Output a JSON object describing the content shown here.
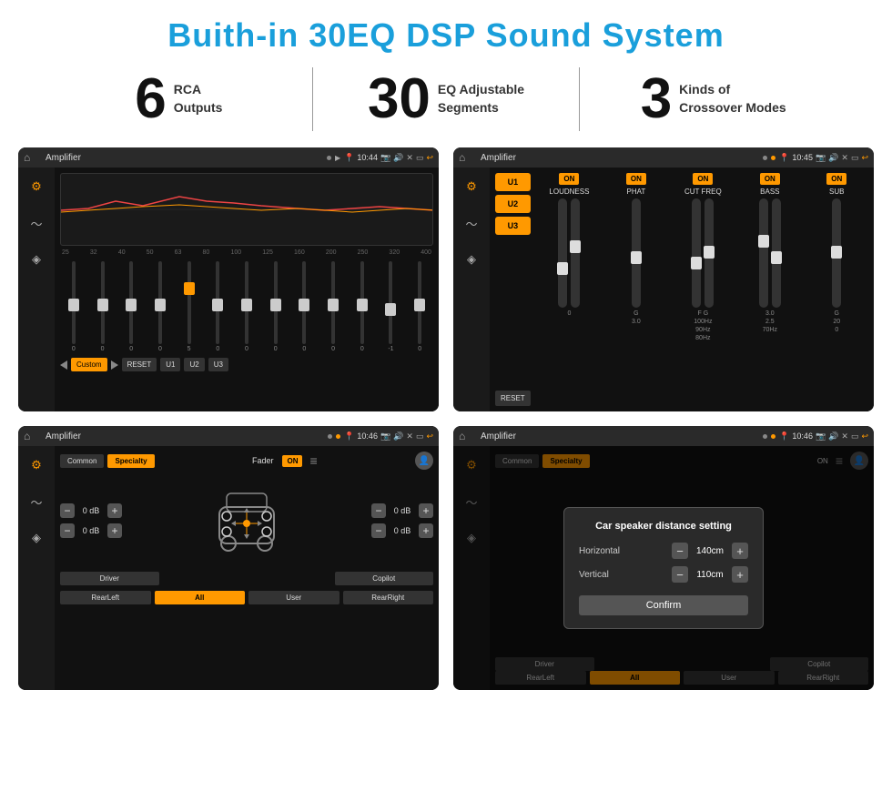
{
  "page": {
    "title": "Buith-in 30EQ DSP Sound System",
    "background": "#ffffff"
  },
  "stats": [
    {
      "number": "6",
      "label": "RCA\nOutputs"
    },
    {
      "number": "30",
      "label": "EQ Adjustable\nSegments"
    },
    {
      "number": "3",
      "label": "Kinds of\nCrossover Modes"
    }
  ],
  "screens": [
    {
      "id": "eq-screen",
      "title": "Amplifier",
      "time": "10:44",
      "type": "eq"
    },
    {
      "id": "crossover-screen",
      "title": "Amplifier",
      "time": "10:45",
      "type": "crossover"
    },
    {
      "id": "fader-screen",
      "title": "Amplifier",
      "time": "10:46",
      "type": "fader"
    },
    {
      "id": "dialog-screen",
      "title": "Amplifier",
      "time": "10:46",
      "type": "dialog"
    }
  ],
  "eq": {
    "frequencies": [
      "25",
      "32",
      "40",
      "50",
      "63",
      "80",
      "100",
      "125",
      "160",
      "200",
      "250",
      "320",
      "400"
    ],
    "values": [
      "0",
      "0",
      "0",
      "0",
      "5",
      "0",
      "0",
      "0",
      "0",
      "0",
      "0",
      "-1",
      "0"
    ],
    "preset": "Custom",
    "buttons": [
      "RESET",
      "U1",
      "U2",
      "U3"
    ]
  },
  "crossover": {
    "presets": [
      "U1",
      "U2",
      "U3"
    ],
    "sections": [
      "LOUDNESS",
      "PHAT",
      "CUT FREQ",
      "BASS",
      "SUB"
    ],
    "reset_label": "RESET"
  },
  "fader": {
    "tabs": [
      "Common",
      "Specialty"
    ],
    "fader_label": "Fader",
    "on_label": "ON",
    "vol_rows": [
      "0 dB",
      "0 dB",
      "0 dB",
      "0 dB"
    ],
    "buttons": [
      "Driver",
      "Copilot",
      "RearLeft",
      "All",
      "User",
      "RearRight"
    ]
  },
  "dialog": {
    "title": "Car speaker distance setting",
    "horizontal_label": "Horizontal",
    "horizontal_value": "140cm",
    "vertical_label": "Vertical",
    "vertical_value": "110cm",
    "confirm_label": "Confirm",
    "tabs": [
      "Common",
      "Specialty"
    ],
    "buttons": [
      "Driver",
      "Copilot",
      "RearLeft",
      "User",
      "RearRight"
    ]
  }
}
